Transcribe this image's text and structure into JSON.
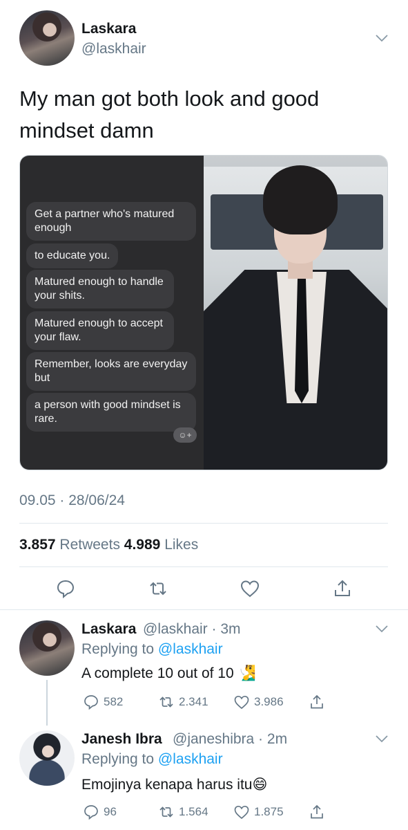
{
  "tweet": {
    "author_name": "Laskara",
    "author_handle": "@laskhair",
    "text": "My man got both look and good mindset damn",
    "timestamp": "09.05 · 28/06/24",
    "retweets_count": "3.857",
    "retweets_label": "Retweets",
    "likes_count": "4.989",
    "likes_label": "Likes",
    "chat_bubbles": [
      "Get a partner who's matured enough",
      "to educate you.",
      "Matured enough to handle your shits.",
      "Matured enough to accept your flaw.",
      "Remember, looks are everyday but",
      "a person with good mindset is rare."
    ],
    "emoji_badge": "☺+"
  },
  "replies": [
    {
      "name": "Laskara",
      "handle": "@laskhair",
      "time": "3m",
      "replying_label": "Replying to",
      "replying_to": "@laskhair",
      "text": "A complete 10 out of 10 🧏‍♂️",
      "reply_count": "582",
      "retweet_count": "2.341",
      "like_count": "3.986"
    },
    {
      "name": "Janesh Ibra",
      "handle": "@janeshibra",
      "time": "2m",
      "replying_label": "Replying to",
      "replying_to": "@laskhair",
      "text": "Emojinya kenapa harus itu😄",
      "reply_count": "96",
      "retweet_count": "1.564",
      "like_count": "1.875"
    }
  ],
  "icons": {
    "reply": "reply-icon",
    "retweet": "retweet-icon",
    "like": "heart-icon",
    "share": "share-icon",
    "more": "chevron-down-icon"
  },
  "colors": {
    "link": "#1da1f2",
    "secondary": "#657786",
    "primary": "#14171a"
  }
}
